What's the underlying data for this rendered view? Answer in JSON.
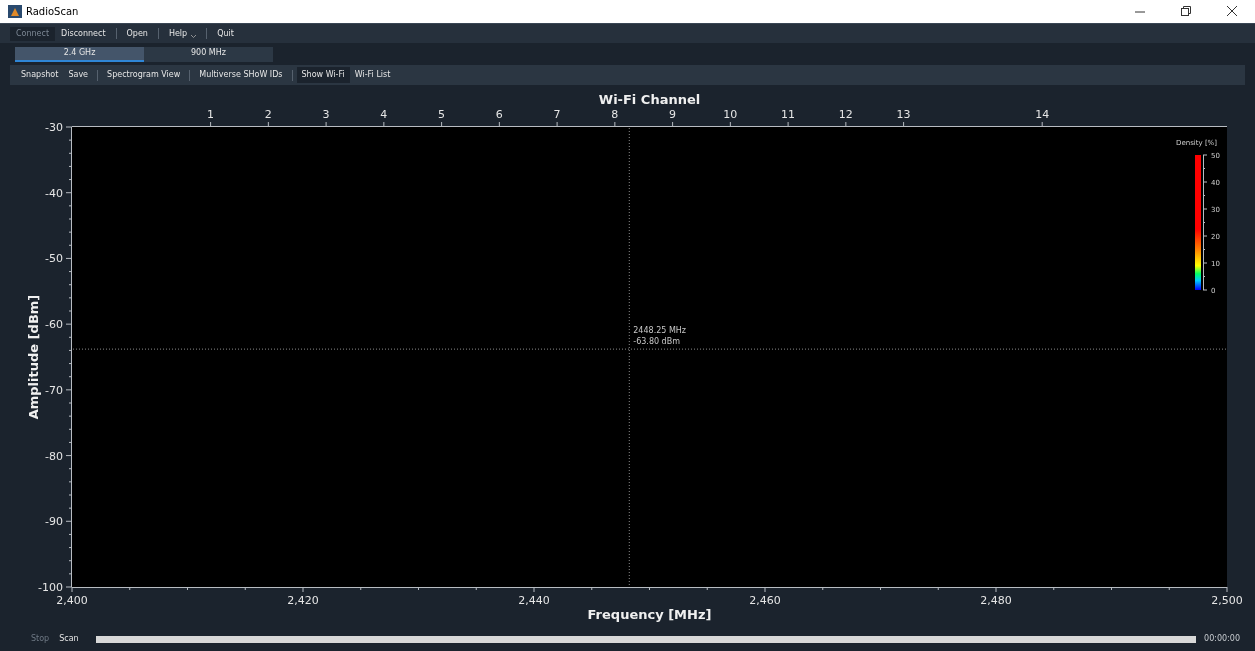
{
  "window": {
    "title": "RadioScan"
  },
  "menu_groups": [
    [
      {
        "label": "Connect",
        "disabled": true,
        "dropdown": false
      },
      {
        "label": "Disconnect",
        "disabled": false,
        "dropdown": false
      }
    ],
    [
      {
        "label": "Open",
        "disabled": false,
        "dropdown": false
      }
    ],
    [
      {
        "label": "Help",
        "disabled": false,
        "dropdown": true
      }
    ],
    [
      {
        "label": "Quit",
        "disabled": false,
        "dropdown": false
      }
    ]
  ],
  "band_tabs": [
    {
      "label": "2.4 GHz",
      "selected": true
    },
    {
      "label": "900 MHz",
      "selected": false
    }
  ],
  "toolbar_groups": [
    [
      {
        "label": "Snapshot",
        "checked": false
      },
      {
        "label": "Save",
        "checked": false
      }
    ],
    [
      {
        "label": "Spectrogram View",
        "checked": false
      }
    ],
    [
      {
        "label": "Multiverse SHoW IDs",
        "checked": false
      }
    ],
    [
      {
        "label": "Show Wi-Fi",
        "checked": true
      },
      {
        "label": "Wi-Fi List",
        "checked": false
      }
    ]
  ],
  "spectrum": {
    "chart_data": {
      "type": "line",
      "xlabel": "Frequency [MHz]",
      "ylabel": "Amplitude [dBm]",
      "xlim": [
        2400,
        2500
      ],
      "ylim": [
        -100,
        -30
      ],
      "xticks": [
        {
          "value": 2400,
          "label": "2,400"
        },
        {
          "value": 2420,
          "label": "2,420"
        },
        {
          "value": 2440,
          "label": "2,440"
        },
        {
          "value": 2460,
          "label": "2,460"
        },
        {
          "value": 2480,
          "label": "2,480"
        },
        {
          "value": 2500,
          "label": "2,500"
        }
      ],
      "yticks": [
        -30,
        -40,
        -50,
        -60,
        -70,
        -80,
        -90,
        -100
      ],
      "ref_lines": [
        {
          "axis": "x",
          "value": 2448.25
        },
        {
          "axis": "y",
          "value": -63.8
        }
      ],
      "annotations": [
        {
          "text": "2448.25 MHz"
        },
        {
          "text": "-63.80 dBm"
        }
      ]
    },
    "channel_axis": {
      "title": "Wi-Fi Channel",
      "ticks": [
        "1",
        "2",
        "3",
        "4",
        "5",
        "6",
        "7",
        "8",
        "9",
        "10",
        "11",
        "12",
        "13",
        "14"
      ]
    },
    "density_scale": {
      "title": "Density [%]",
      "ticks": [
        "50",
        "40",
        "30",
        "20",
        "10",
        "0"
      ]
    }
  },
  "status_bar": {
    "stop": {
      "label": "Stop",
      "disabled": true
    },
    "scan": {
      "label": "Scan",
      "disabled": false
    },
    "progress": {
      "level": 1
    },
    "elapsed": "00:00:00"
  }
}
